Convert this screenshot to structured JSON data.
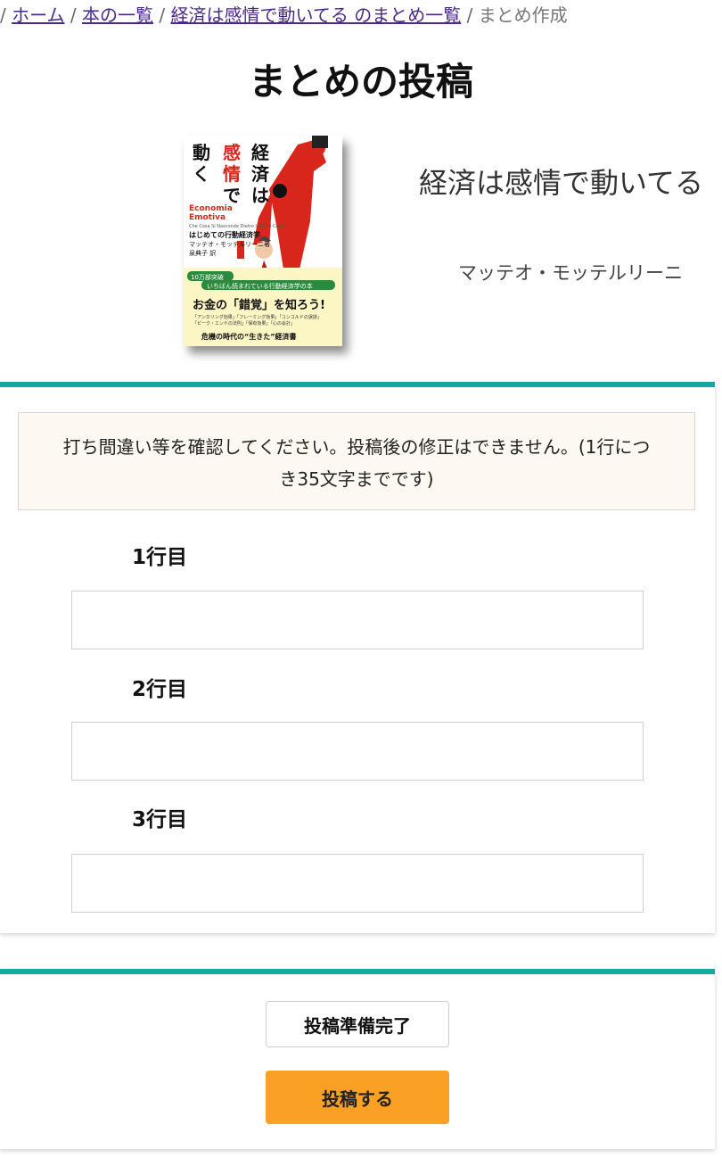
{
  "breadcrumb": {
    "separator": "/",
    "links": [
      "ホーム",
      "本の一覧",
      "経済は感情で動いてる のまとめ一覧"
    ],
    "current": "まとめ作成"
  },
  "page_title": "まとめの投稿",
  "book": {
    "title": "経済は感情で動いてる",
    "author": "マッテオ・モッテルリーニ",
    "cover": {
      "title_lines": [
        "経済は",
        "感情で",
        "動く"
      ],
      "italian_title": "Economia Emotiva",
      "italian_subtitle": "Che Cosa Si Nasconde Dietro I Nostri Conti Quotidiani",
      "subtitle": "はじめての行動経済学",
      "author_line": "マッテオ・モッテルリーニ著",
      "translator_line": "泉典子 訳",
      "badge": "10万部突破",
      "band_line1": "いちばん読まれている行動経済学の本",
      "catch": "お金の「錯覚」を知ろう!",
      "topics": "「アンカリング効果」「フレーミング効果」「コンコルドの誤謬」「ピーク・エンドの法則」「保有効果」「心の会計」",
      "footer": "危機の時代の“生きた”経済書"
    }
  },
  "notice": {
    "text": "打ち間違い等を確認してください。投稿後の修正はできません。(1行につき35文字までです)"
  },
  "fields": [
    {
      "label": "1行目",
      "value": "",
      "placeholder": ""
    },
    {
      "label": "2行目",
      "value": "",
      "placeholder": ""
    },
    {
      "label": "3行目",
      "value": "",
      "placeholder": ""
    }
  ],
  "buttons": {
    "ready_label": "投稿準備完了",
    "submit_label": "投稿する"
  },
  "colors": {
    "accent_teal": "#13aaa2",
    "submit_orange": "#faa024",
    "notice_bg": "#fdf8f1",
    "link_purple": "#4a2a8a"
  }
}
